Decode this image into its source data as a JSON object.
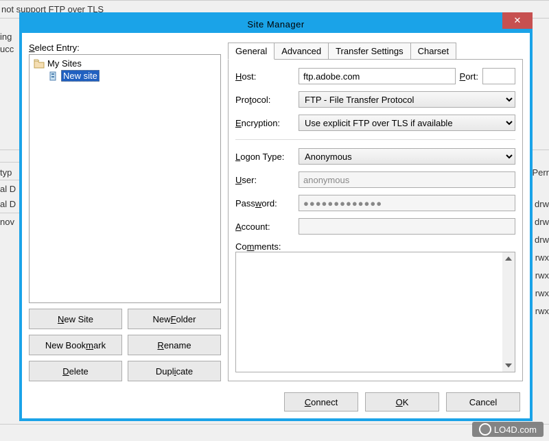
{
  "dialog": {
    "title": "Site Manager",
    "close_text": "✕"
  },
  "left": {
    "select_entry_label": "Select Entry:",
    "tree": {
      "root_label": "My Sites",
      "site_label": "New site"
    },
    "buttons": {
      "new_site": "New Site",
      "new_folder": "New Folder",
      "new_bookmark": "New Bookmark",
      "rename": "Rename",
      "delete": "Delete",
      "duplicate": "Duplicate"
    }
  },
  "tabs": {
    "general": "General",
    "advanced": "Advanced",
    "transfer_settings": "Transfer Settings",
    "charset": "Charset"
  },
  "form": {
    "host_label": "Host:",
    "host_value": "ftp.adobe.com",
    "port_label": "Port:",
    "port_value": "",
    "protocol_label": "Protocol:",
    "protocol_value": "FTP - File Transfer Protocol",
    "encryption_label": "Encryption:",
    "encryption_value": "Use explicit FTP over TLS if available",
    "logon_type_label": "Logon Type:",
    "logon_type_value": "Anonymous",
    "user_label": "User:",
    "user_value": "anonymous",
    "password_label": "Password:",
    "password_value": "●●●●●●●●●●●●●",
    "account_label": "Account:",
    "account_value": "",
    "comments_label": "Comments:",
    "comments_value": ""
  },
  "footer": {
    "connect": "Connect",
    "ok": "OK",
    "cancel": "Cancel"
  },
  "background": {
    "text1": "not support FTP over TLS",
    "text2": "ing",
    "text3": "ucc",
    "typ": "typ",
    "al_d1": "al D",
    "al_d2": "al D",
    "nov": "nov",
    "perr": "Perr",
    "drw1": "drw",
    "drw2": "drw",
    "drw3": "drw",
    "rwx1": "rwx",
    "rwx2": "rwx",
    "rwx3": "rwx",
    "rwx4": "rwx"
  },
  "watermark": {
    "text": "LO4D.com"
  }
}
